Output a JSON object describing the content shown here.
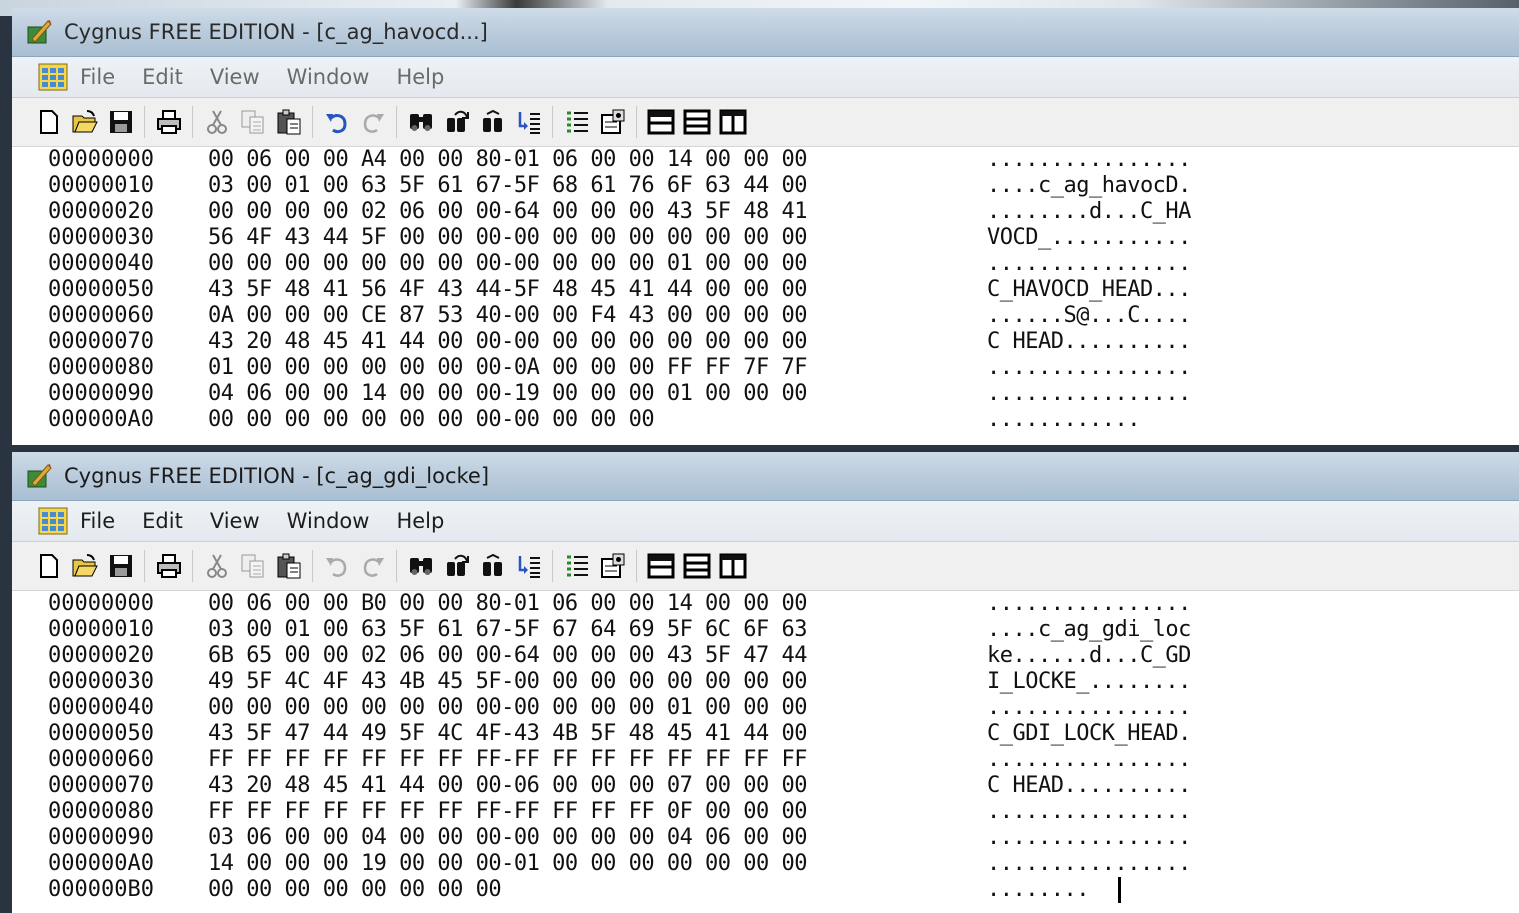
{
  "windows": [
    {
      "title": "Cygnus FREE EDITION - [c_ag_havocd...]",
      "menu": [
        "File",
        "Edit",
        "View",
        "Window",
        "Help"
      ],
      "toolbar_icons": [
        "new-file-icon",
        "open-folder-icon",
        "save-disk-icon",
        "|",
        "print-icon",
        "|",
        "cut-icon",
        "copy-icon",
        "paste-icon",
        "|",
        "undo-icon",
        "redo-icon",
        "|",
        "find-binoculars-icon",
        "find-replace-icon",
        "find-next-icon",
        "goto-icon",
        "|",
        "properties-list-icon",
        "settings-icon",
        "|",
        "split-horizontal-icon",
        "split-rows-icon",
        "split-vertical-icon"
      ],
      "rows": [
        {
          "addr": "00000000",
          "hex": "00 06 00 00 A4 00 00 80-01 06 00 00 14 00 00 00",
          "ascii": "................"
        },
        {
          "addr": "00000010",
          "hex": "03 00 01 00 63 5F 61 67-5F 68 61 76 6F 63 44 00",
          "ascii": "....c_ag_havocD."
        },
        {
          "addr": "00000020",
          "hex": "00 00 00 00 02 06 00 00-64 00 00 00 43 5F 48 41",
          "ascii": "........d...C_HA"
        },
        {
          "addr": "00000030",
          "hex": "56 4F 43 44 5F 00 00 00-00 00 00 00 00 00 00 00",
          "ascii": "VOCD_..........."
        },
        {
          "addr": "00000040",
          "hex": "00 00 00 00 00 00 00 00-00 00 00 00 01 00 00 00",
          "ascii": "................"
        },
        {
          "addr": "00000050",
          "hex": "43 5F 48 41 56 4F 43 44-5F 48 45 41 44 00 00 00",
          "ascii": "C_HAVOCD_HEAD..."
        },
        {
          "addr": "00000060",
          "hex": "0A 00 00 00 CE 87 53 40-00 00 F4 43 00 00 00 00",
          "ascii": "......S@...C...."
        },
        {
          "addr": "00000070",
          "hex": "43 20 48 45 41 44 00 00-00 00 00 00 00 00 00 00",
          "ascii": "C HEAD.........."
        },
        {
          "addr": "00000080",
          "hex": "01 00 00 00 00 00 00 00-0A 00 00 00 FF FF 7F 7F",
          "ascii": "................"
        },
        {
          "addr": "00000090",
          "hex": "04 06 00 00 14 00 00 00-19 00 00 00 01 00 00 00",
          "ascii": "................"
        },
        {
          "addr": "000000A0",
          "hex": "00 00 00 00 00 00 00 00-00 00 00 00",
          "ascii": "............"
        }
      ]
    },
    {
      "title": "Cygnus FREE EDITION - [c_ag_gdi_locke]",
      "menu": [
        "File",
        "Edit",
        "View",
        "Window",
        "Help"
      ],
      "toolbar_icons": [
        "new-file-icon",
        "open-folder-icon",
        "save-disk-icon",
        "|",
        "print-icon",
        "|",
        "cut-icon",
        "copy-icon",
        "paste-icon",
        "|",
        "undo-icon",
        "redo-icon",
        "|",
        "find-binoculars-icon",
        "find-replace-icon",
        "find-next-icon",
        "goto-icon",
        "|",
        "properties-list-icon",
        "settings-icon",
        "|",
        "split-horizontal-icon",
        "split-rows-icon",
        "split-vertical-icon"
      ],
      "rows": [
        {
          "addr": "00000000",
          "hex": "00 06 00 00 B0 00 00 80-01 06 00 00 14 00 00 00",
          "ascii": "................"
        },
        {
          "addr": "00000010",
          "hex": "03 00 01 00 63 5F 61 67-5F 67 64 69 5F 6C 6F 63",
          "ascii": "....c_ag_gdi_loc"
        },
        {
          "addr": "00000020",
          "hex": "6B 65 00 00 02 06 00 00-64 00 00 00 43 5F 47 44",
          "ascii": "ke......d...C_GD"
        },
        {
          "addr": "00000030",
          "hex": "49 5F 4C 4F 43 4B 45 5F-00 00 00 00 00 00 00 00",
          "ascii": "I_LOCKE_........"
        },
        {
          "addr": "00000040",
          "hex": "00 00 00 00 00 00 00 00-00 00 00 00 01 00 00 00",
          "ascii": "................"
        },
        {
          "addr": "00000050",
          "hex": "43 5F 47 44 49 5F 4C 4F-43 4B 5F 48 45 41 44 00",
          "ascii": "C_GDI_LOCK_HEAD."
        },
        {
          "addr": "00000060",
          "hex": "FF FF FF FF FF FF FF FF-FF FF FF FF FF FF FF FF",
          "ascii": "................"
        },
        {
          "addr": "00000070",
          "hex": "43 20 48 45 41 44 00 00-06 00 00 00 07 00 00 00",
          "ascii": "C HEAD.........."
        },
        {
          "addr": "00000080",
          "hex": "FF FF FF FF FF FF FF FF-FF FF FF FF 0F 00 00 00",
          "ascii": "................"
        },
        {
          "addr": "00000090",
          "hex": "03 06 00 00 04 00 00 00-00 00 00 00 04 06 00 00",
          "ascii": "................"
        },
        {
          "addr": "000000A0",
          "hex": "14 00 00 00 19 00 00 00-01 00 00 00 00 00 00 00",
          "ascii": "................"
        },
        {
          "addr": "000000B0",
          "hex": "00 00 00 00 00 00 00 00",
          "ascii": "........"
        }
      ]
    }
  ]
}
